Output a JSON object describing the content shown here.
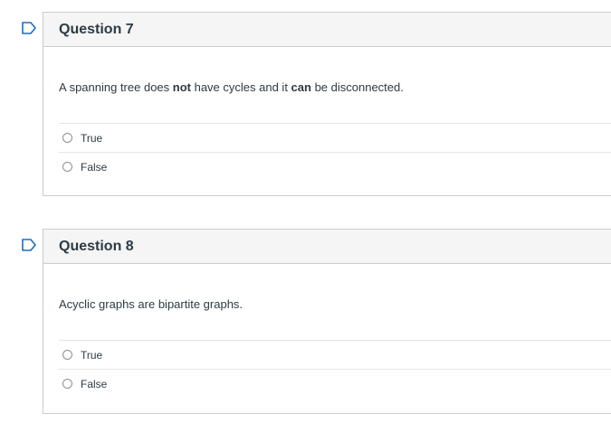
{
  "questions": [
    {
      "title": "Question 7",
      "text_parts": [
        "A spanning tree does ",
        "not",
        " have cycles and it ",
        "can",
        " be disconnected."
      ],
      "answers": [
        "True",
        "False"
      ]
    },
    {
      "title": "Question 8",
      "text": "Acyclic graphs are bipartite graphs.",
      "answers": [
        "True",
        "False"
      ]
    }
  ],
  "colors": {
    "flag": "#1b6fc0",
    "header_bg": "#f5f5f5",
    "border": "#c7cdd1"
  }
}
